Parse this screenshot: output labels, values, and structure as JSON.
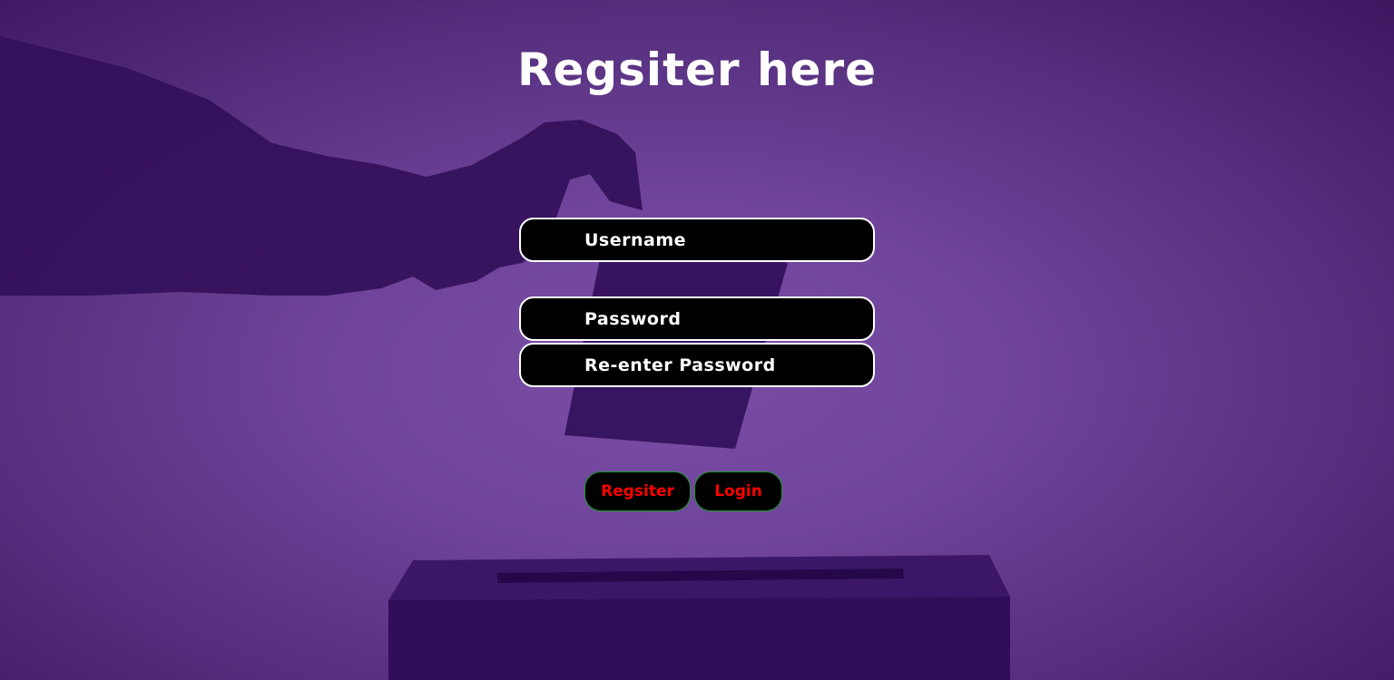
{
  "page": {
    "title": "Regsiter here"
  },
  "form": {
    "username_placeholder": "Username",
    "password_placeholder": "Password",
    "reenter_password_placeholder": "Re-enter Password",
    "register_button_label": "Regsiter",
    "login_button_label": "Login"
  },
  "colors": {
    "background_accent": "#6e4399",
    "silhouette": "#33105a",
    "field_background": "#000000",
    "field_border": "#ffffff",
    "button_text": "#ff0000",
    "button_border": "#1a9a2a"
  },
  "background_image": {
    "subject": "hand-dropping-ballot-into-box-silhouette"
  }
}
